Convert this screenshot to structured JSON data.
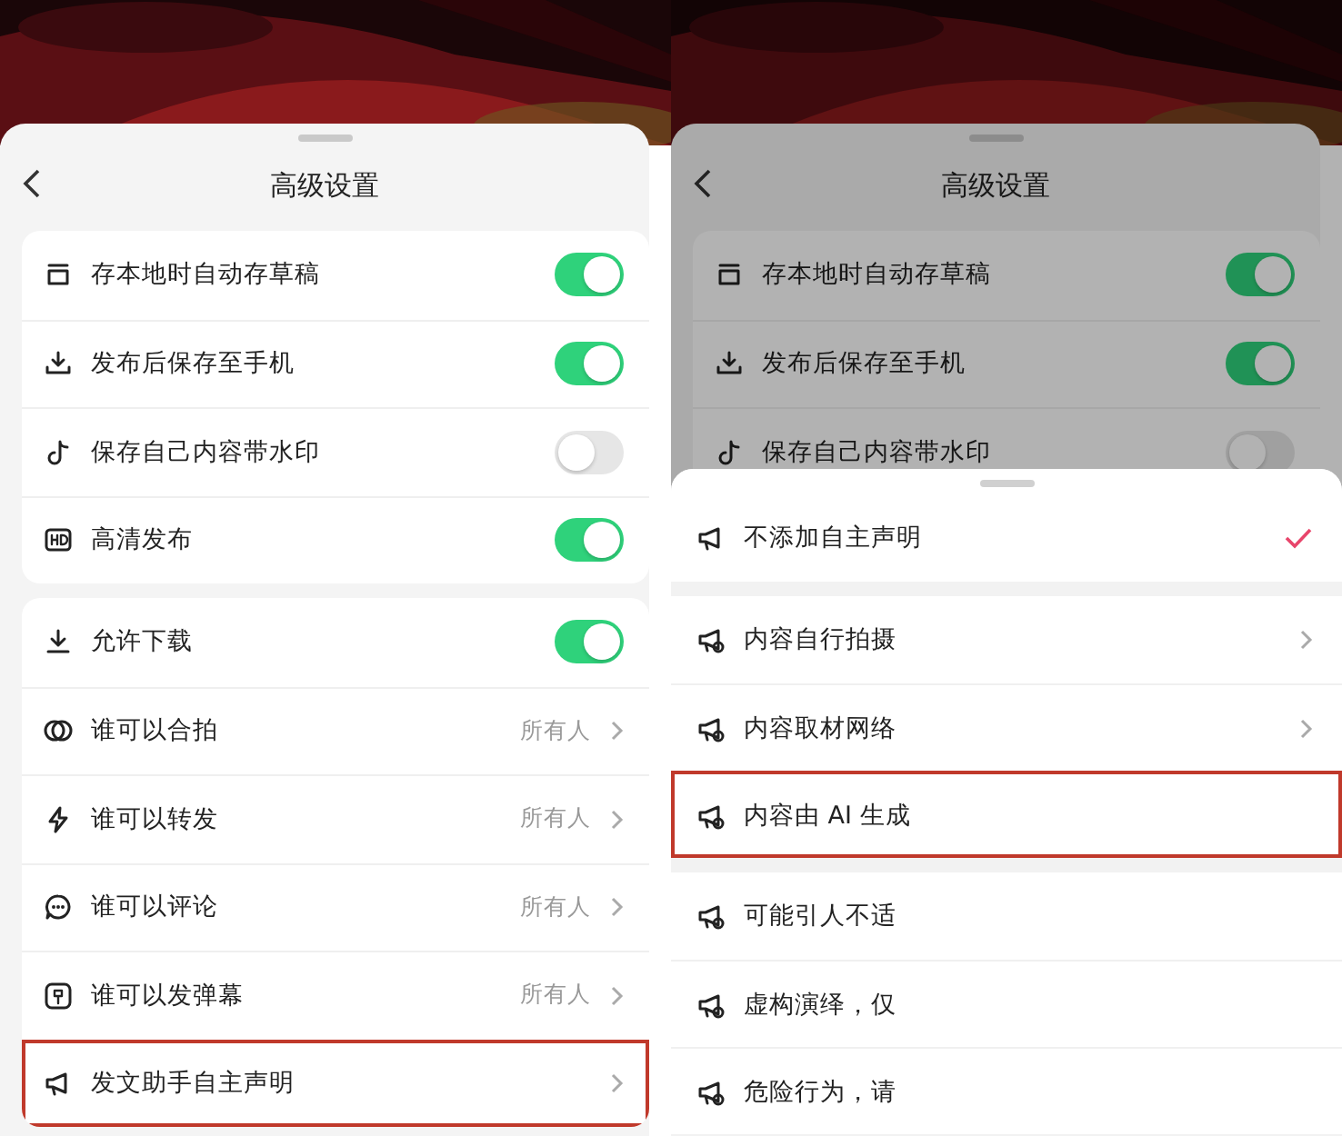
{
  "left": {
    "title": "高级设置",
    "groups": [
      [
        {
          "kind": "toggle",
          "label": "存本地时自动存草稿",
          "on": true,
          "highlighted": false
        },
        {
          "kind": "toggle",
          "label": "发布后保存至手机",
          "on": true,
          "highlighted": false
        },
        {
          "kind": "toggle",
          "label": "保存自己内容带水印",
          "on": false,
          "highlighted": false
        },
        {
          "kind": "toggle",
          "label": "高清发布",
          "on": true,
          "highlighted": false
        }
      ],
      [
        {
          "kind": "toggle",
          "label": "允许下载",
          "on": true,
          "highlighted": false
        },
        {
          "kind": "link",
          "label": "谁可以合拍",
          "value": "所有人",
          "highlighted": false
        },
        {
          "kind": "link",
          "label": "谁可以转发",
          "value": "所有人",
          "highlighted": false
        },
        {
          "kind": "link",
          "label": "谁可以评论",
          "value": "所有人",
          "highlighted": false
        },
        {
          "kind": "link",
          "label": "谁可以发弹幕",
          "value": "所有人",
          "highlighted": false
        },
        {
          "kind": "link",
          "label": "发文助手自主声明",
          "highlighted": true
        }
      ]
    ]
  },
  "right": {
    "title": "高级设置",
    "rows": [
      {
        "kind": "toggle",
        "label": "存本地时自动存草稿",
        "on": true
      },
      {
        "kind": "toggle",
        "label": "发布后保存至手机",
        "on": true
      },
      {
        "kind": "toggle",
        "label": "保存自己内容带水印",
        "on": false
      }
    ],
    "sheet": {
      "groups": [
        [
          {
            "label": "不添加自主声明",
            "selected": true,
            "chevron": false,
            "highlighted": false
          }
        ],
        [
          {
            "label": "内容自行拍摄",
            "selected": false,
            "chevron": true,
            "highlighted": false
          },
          {
            "label": "内容取材网络",
            "selected": false,
            "chevron": true,
            "highlighted": false
          },
          {
            "label": "内容由 AI 生成",
            "selected": false,
            "chevron": false,
            "highlighted": true
          }
        ],
        [
          {
            "label": "可能引人不适",
            "selected": false,
            "chevron": false,
            "highlighted": false
          },
          {
            "label": "虚构演绎，仅",
            "selected": false,
            "chevron": false,
            "highlighted": false
          },
          {
            "label": "危险行为，请",
            "selected": false,
            "chevron": false,
            "highlighted": false
          }
        ]
      ]
    }
  }
}
